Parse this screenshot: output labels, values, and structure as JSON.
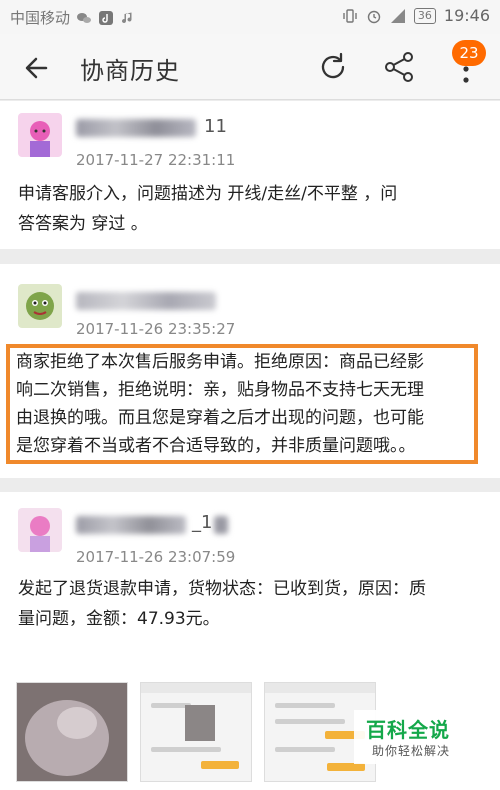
{
  "status_bar": {
    "carrier": "中国移动",
    "battery": "36",
    "time": "19:46"
  },
  "header": {
    "title": "协商历史",
    "badge": "23"
  },
  "icons": [
    "back-icon",
    "refresh-icon",
    "share-icon",
    "more-icon",
    "wechat-icon",
    "tiktok-icon",
    "music-icon",
    "vibrate-icon",
    "alarm-icon",
    "signal-icon"
  ],
  "messages": [
    {
      "name_suffix": "11",
      "timestamp": "2017-11-27 22:31:11",
      "lines": [
        "申请客服介入，问题描述为 开线/走丝/不平整 ，问",
        "答答案为 穿过 。"
      ]
    },
    {
      "timestamp": "2017-11-26 23:35:27",
      "lines": [
        "商家拒绝了本次售后服务申请。拒绝原因：商品已经影",
        "响二次销售，拒绝说明：亲，贴身物品不支持七天无理",
        "由退换的哦。而且您是穿着之后才出现的问题，也可能",
        "是您穿着不当或者不合适导致的，并非质量问题哦。。"
      ]
    },
    {
      "name_suffix": "_1",
      "timestamp": "2017-11-26 23:07:59",
      "lines": [
        "发起了退货退款申请，货物状态：已收到货，原因：质",
        "量问题，金额：47.93元。"
      ]
    }
  ],
  "watermark": {
    "title": "百科全说",
    "subtitle": "助你轻松解决"
  }
}
